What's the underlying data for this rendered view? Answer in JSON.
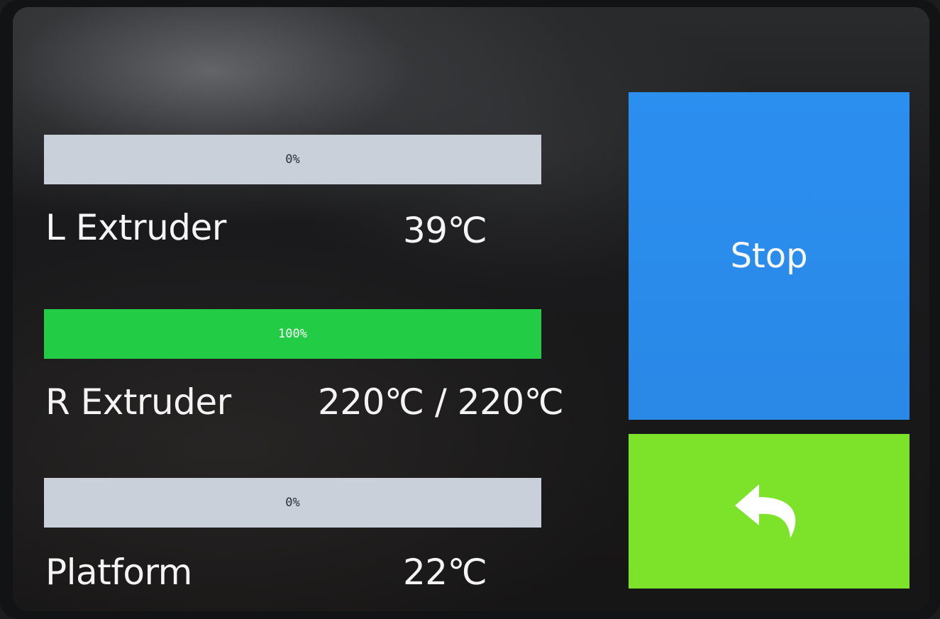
{
  "heaters": [
    {
      "name": "L Extruder",
      "temperature": "39℃",
      "progress_label": "0%",
      "progress": 0
    },
    {
      "name": "R Extruder",
      "temperature": "220℃ / 220℃",
      "progress_label": "100%",
      "progress": 100
    },
    {
      "name": "Platform",
      "temperature": "22℃",
      "progress_label": "0%",
      "progress": 0
    }
  ],
  "buttons": {
    "stop_label": "Stop",
    "back_icon": "back-arrow-icon"
  },
  "colors": {
    "progress_track": "#c9d0da",
    "progress_fill": "#22cc44",
    "stop_button": "#2b8ff0",
    "back_button": "#7de22a"
  }
}
